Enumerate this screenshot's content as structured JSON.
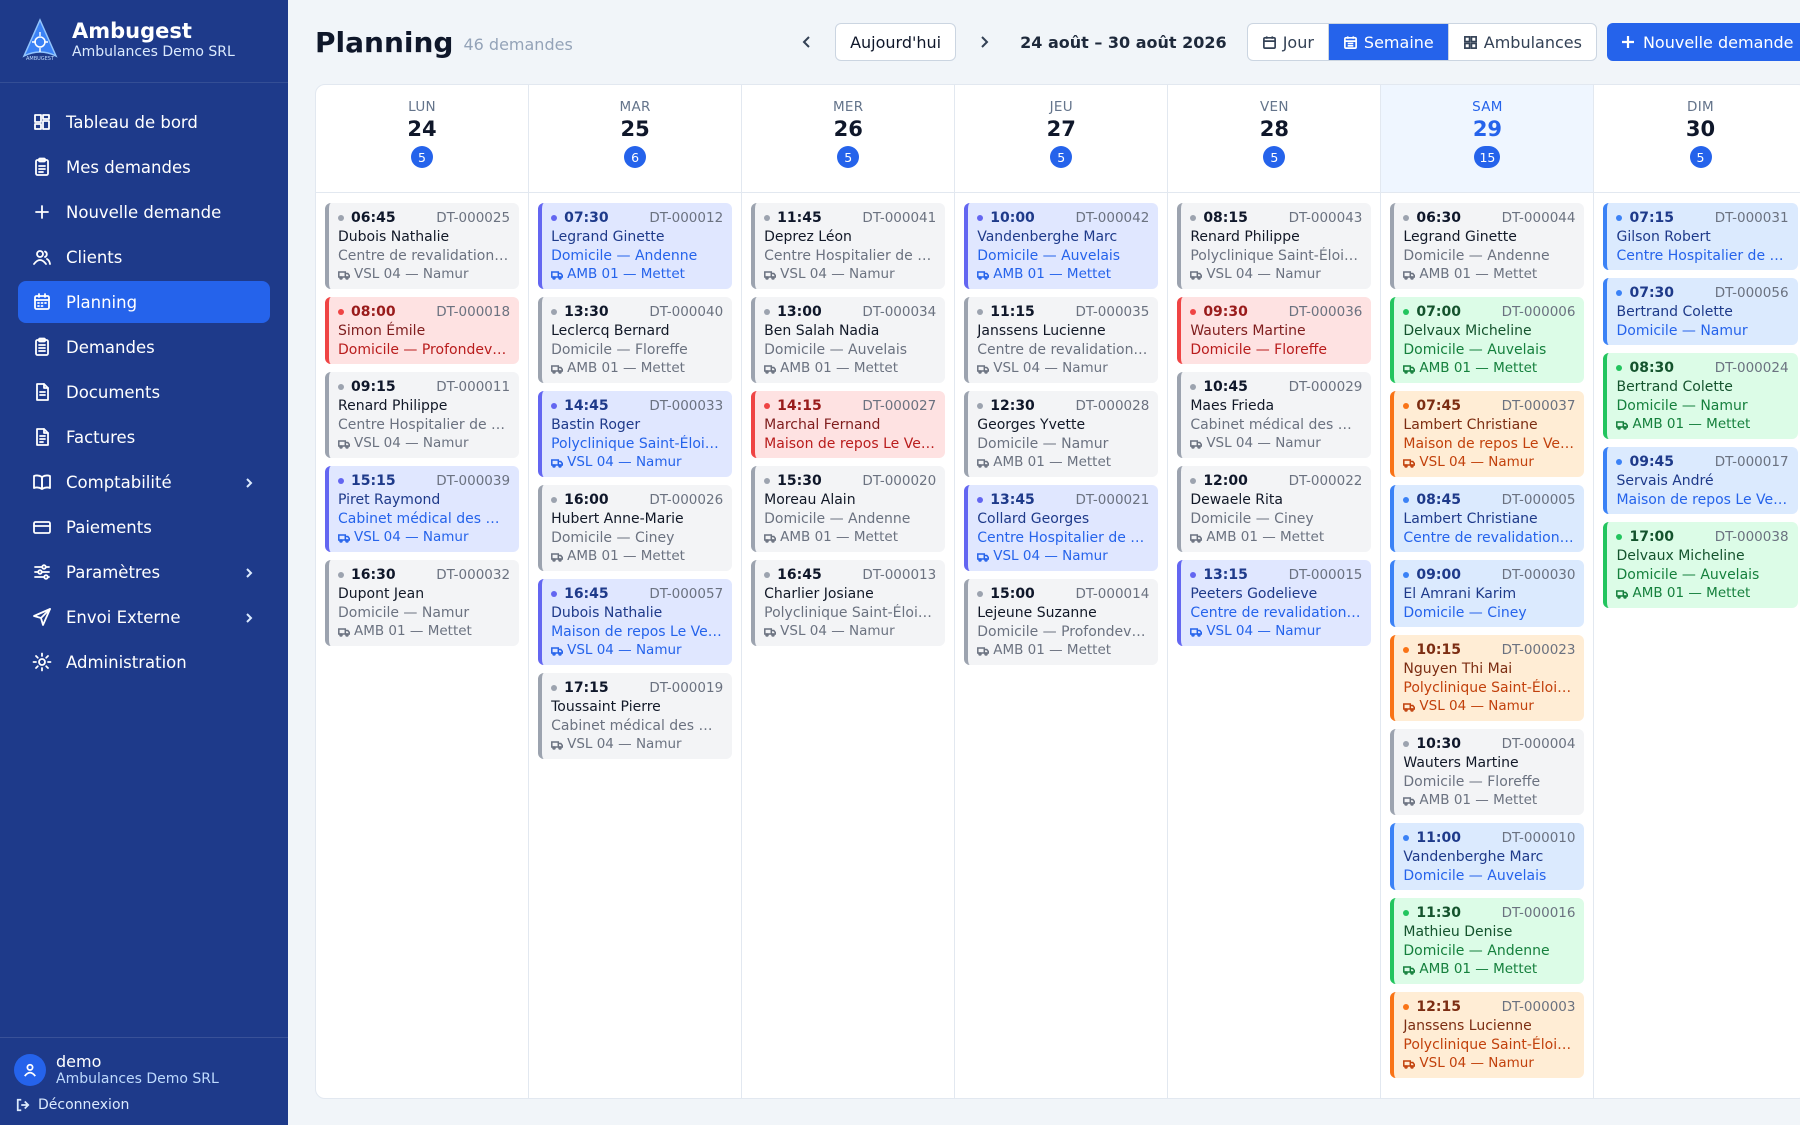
{
  "brand": {
    "title": "Ambugest",
    "subtitle": "Ambulances Demo SRL",
    "logo_text": "AMBUGEST"
  },
  "sidebar": {
    "items": [
      {
        "label": "Tableau de bord",
        "icon": "dashboard-icon",
        "active": false,
        "chevron": false
      },
      {
        "label": "Mes demandes",
        "icon": "clipboard-icon",
        "active": false,
        "chevron": false
      },
      {
        "label": "Nouvelle demande",
        "icon": "plus-icon",
        "active": false,
        "chevron": false
      },
      {
        "label": "Clients",
        "icon": "users-icon",
        "active": false,
        "chevron": false
      },
      {
        "label": "Planning",
        "icon": "calendar-icon",
        "active": true,
        "chevron": false
      },
      {
        "label": "Demandes",
        "icon": "clipboard-list-icon",
        "active": false,
        "chevron": false
      },
      {
        "label": "Documents",
        "icon": "document-icon",
        "active": false,
        "chevron": false
      },
      {
        "label": "Factures",
        "icon": "invoice-icon",
        "active": false,
        "chevron": false
      },
      {
        "label": "Comptabilité",
        "icon": "book-icon",
        "active": false,
        "chevron": true
      },
      {
        "label": "Paiements",
        "icon": "credit-card-icon",
        "active": false,
        "chevron": false
      },
      {
        "label": "Paramètres",
        "icon": "sliders-icon",
        "active": false,
        "chevron": true
      },
      {
        "label": "Envoi Externe",
        "icon": "send-icon",
        "active": false,
        "chevron": true
      },
      {
        "label": "Administration",
        "icon": "gear-icon",
        "active": false,
        "chevron": false
      }
    ]
  },
  "user": {
    "name": "demo",
    "org": "Ambulances Demo SRL",
    "logout_label": "Déconnexion"
  },
  "header": {
    "title": "Planning",
    "count": "46 demandes",
    "today_label": "Aujourd'hui",
    "date_range": "24 août – 30 août 2026",
    "views": [
      {
        "label": "Jour",
        "icon": "calendar-day-icon",
        "active": false
      },
      {
        "label": "Semaine",
        "icon": "calendar-week-icon",
        "active": true
      },
      {
        "label": "Ambulances",
        "icon": "grid-icon",
        "active": false
      }
    ],
    "new_label": "Nouvelle demande"
  },
  "colors": {
    "sidebar": "#1e3a8a",
    "accent": "#2563eb"
  },
  "days": [
    {
      "name": "LUN",
      "num": "24",
      "count": "5",
      "today": false,
      "cards": [
        {
          "time": "06:45",
          "id": "DT-000025",
          "name": "Dubois Nathalie",
          "loc": "Centre de revalidation…",
          "veh": "VSL 04 — Namur",
          "color": "gray"
        },
        {
          "time": "08:00",
          "id": "DT-000018",
          "name": "Simon Émile",
          "loc": "Domicile — Profondevi…",
          "veh": "",
          "color": "red"
        },
        {
          "time": "09:15",
          "id": "DT-000011",
          "name": "Renard Philippe",
          "loc": "Centre Hospitalier de …",
          "veh": "VSL 04 — Namur",
          "color": "gray"
        },
        {
          "time": "15:15",
          "id": "DT-000039",
          "name": "Piret Raymond",
          "loc": "Cabinet médical des Q…",
          "veh": "VSL 04 — Namur",
          "color": "indigo"
        },
        {
          "time": "16:30",
          "id": "DT-000032",
          "name": "Dupont Jean",
          "loc": "Domicile — Namur",
          "veh": "AMB 01 — Mettet",
          "color": "gray"
        }
      ]
    },
    {
      "name": "MAR",
      "num": "25",
      "count": "6",
      "today": false,
      "cards": [
        {
          "time": "07:30",
          "id": "DT-000012",
          "name": "Legrand Ginette",
          "loc": "Domicile — Andenne",
          "veh": "AMB 01 — Mettet",
          "color": "indigo"
        },
        {
          "time": "13:30",
          "id": "DT-000040",
          "name": "Leclercq Bernard",
          "loc": "Domicile — Floreffe",
          "veh": "AMB 01 — Mettet",
          "color": "gray"
        },
        {
          "time": "14:45",
          "id": "DT-000033",
          "name": "Bastin Roger",
          "loc": "Polyclinique Saint-Éloi …",
          "veh": "VSL 04 — Namur",
          "color": "indigo"
        },
        {
          "time": "16:00",
          "id": "DT-000026",
          "name": "Hubert Anne-Marie",
          "loc": "Domicile — Ciney",
          "veh": "AMB 01 — Mettet",
          "color": "gray"
        },
        {
          "time": "16:45",
          "id": "DT-000057",
          "name": "Dubois Nathalie",
          "loc": "Maison de repos Le Ve…",
          "veh": "VSL 04 — Namur",
          "color": "indigo"
        },
        {
          "time": "17:15",
          "id": "DT-000019",
          "name": "Toussaint Pierre",
          "loc": "Cabinet médical des Q…",
          "veh": "VSL 04 — Namur",
          "color": "gray"
        }
      ]
    },
    {
      "name": "MER",
      "num": "26",
      "count": "5",
      "today": false,
      "cards": [
        {
          "time": "11:45",
          "id": "DT-000041",
          "name": "Deprez Léon",
          "loc": "Centre Hospitalier de …",
          "veh": "VSL 04 — Namur",
          "color": "gray"
        },
        {
          "time": "13:00",
          "id": "DT-000034",
          "name": "Ben Salah Nadia",
          "loc": "Domicile — Auvelais",
          "veh": "AMB 01 — Mettet",
          "color": "gray"
        },
        {
          "time": "14:15",
          "id": "DT-000027",
          "name": "Marchal Fernand",
          "loc": "Maison de repos Le Ve…",
          "veh": "",
          "color": "red"
        },
        {
          "time": "15:30",
          "id": "DT-000020",
          "name": "Moreau Alain",
          "loc": "Domicile — Andenne",
          "veh": "AMB 01 — Mettet",
          "color": "gray"
        },
        {
          "time": "16:45",
          "id": "DT-000013",
          "name": "Charlier Josiane",
          "loc": "Polyclinique Saint-Éloi …",
          "veh": "VSL 04 — Namur",
          "color": "gray"
        }
      ]
    },
    {
      "name": "JEU",
      "num": "27",
      "count": "5",
      "today": false,
      "cards": [
        {
          "time": "10:00",
          "id": "DT-000042",
          "name": "Vandenberghe Marc",
          "loc": "Domicile — Auvelais",
          "veh": "AMB 01 — Mettet",
          "color": "indigo"
        },
        {
          "time": "11:15",
          "id": "DT-000035",
          "name": "Janssens Lucienne",
          "loc": "Centre de revalidation…",
          "veh": "VSL 04 — Namur",
          "color": "gray"
        },
        {
          "time": "12:30",
          "id": "DT-000028",
          "name": "Georges Yvette",
          "loc": "Domicile — Namur",
          "veh": "AMB 01 — Mettet",
          "color": "gray"
        },
        {
          "time": "13:45",
          "id": "DT-000021",
          "name": "Collard Georges",
          "loc": "Centre Hospitalier de …",
          "veh": "VSL 04 — Namur",
          "color": "indigo"
        },
        {
          "time": "15:00",
          "id": "DT-000014",
          "name": "Lejeune Suzanne",
          "loc": "Domicile — Profondevi…",
          "veh": "AMB 01 — Mettet",
          "color": "gray"
        }
      ]
    },
    {
      "name": "VEN",
      "num": "28",
      "count": "5",
      "today": false,
      "cards": [
        {
          "time": "08:15",
          "id": "DT-000043",
          "name": "Renard Philippe",
          "loc": "Polyclinique Saint-Éloi …",
          "veh": "VSL 04 — Namur",
          "color": "gray"
        },
        {
          "time": "09:30",
          "id": "DT-000036",
          "name": "Wauters Martine",
          "loc": "Domicile — Floreffe",
          "veh": "",
          "color": "red"
        },
        {
          "time": "10:45",
          "id": "DT-000029",
          "name": "Maes Frieda",
          "loc": "Cabinet médical des Q…",
          "veh": "VSL 04 — Namur",
          "color": "gray"
        },
        {
          "time": "12:00",
          "id": "DT-000022",
          "name": "Dewaele Rita",
          "loc": "Domicile — Ciney",
          "veh": "AMB 01 — Mettet",
          "color": "gray"
        },
        {
          "time": "13:15",
          "id": "DT-000015",
          "name": "Peeters Godelieve",
          "loc": "Centre de revalidation…",
          "veh": "VSL 04 — Namur",
          "color": "indigo"
        }
      ]
    },
    {
      "name": "SAM",
      "num": "29",
      "count": "15",
      "today": true,
      "cards": [
        {
          "time": "06:30",
          "id": "DT-000044",
          "name": "Legrand Ginette",
          "loc": "Domicile — Andenne",
          "veh": "AMB 01 — Mettet",
          "color": "gray"
        },
        {
          "time": "07:00",
          "id": "DT-000006",
          "name": "Delvaux Micheline",
          "loc": "Domicile — Auvelais",
          "veh": "AMB 01 — Mettet",
          "color": "green"
        },
        {
          "time": "07:45",
          "id": "DT-000037",
          "name": "Lambert Christiane",
          "loc": "Maison de repos Le Ve…",
          "veh": "VSL 04 — Namur",
          "color": "orange"
        },
        {
          "time": "08:45",
          "id": "DT-000005",
          "name": "Lambert Christiane",
          "loc": "Centre de revalidation…",
          "veh": "",
          "color": "blue"
        },
        {
          "time": "09:00",
          "id": "DT-000030",
          "name": "El Amrani Karim",
          "loc": "Domicile — Ciney",
          "veh": "",
          "color": "blue"
        },
        {
          "time": "10:15",
          "id": "DT-000023",
          "name": "Nguyen Thi Mai",
          "loc": "Polyclinique Saint-Éloi …",
          "veh": "VSL 04 — Namur",
          "color": "orange"
        },
        {
          "time": "10:30",
          "id": "DT-000004",
          "name": "Wauters Martine",
          "loc": "Domicile — Floreffe",
          "veh": "AMB 01 — Mettet",
          "color": "gray"
        },
        {
          "time": "11:00",
          "id": "DT-000010",
          "name": "Vandenberghe Marc",
          "loc": "Domicile — Auvelais",
          "veh": "",
          "color": "blue"
        },
        {
          "time": "11:30",
          "id": "DT-000016",
          "name": "Mathieu Denise",
          "loc": "Domicile — Andenne",
          "veh": "AMB 01 — Mettet",
          "color": "green"
        },
        {
          "time": "12:15",
          "id": "DT-000003",
          "name": "Janssens Lucienne",
          "loc": "Polyclinique Saint-Éloi …",
          "veh": "VSL 04 — Namur",
          "color": "orange"
        }
      ]
    },
    {
      "name": "DIM",
      "num": "30",
      "count": "5",
      "today": false,
      "cards": [
        {
          "time": "07:15",
          "id": "DT-000031",
          "name": "Gilson Robert",
          "loc": "Centre Hospitalier de …",
          "veh": "",
          "color": "blue"
        },
        {
          "time": "07:30",
          "id": "DT-000056",
          "name": "Bertrand Colette",
          "loc": "Domicile — Namur",
          "veh": "",
          "color": "blue"
        },
        {
          "time": "08:30",
          "id": "DT-000024",
          "name": "Bertrand Colette",
          "loc": "Domicile — Namur",
          "veh": "AMB 01 — Mettet",
          "color": "green"
        },
        {
          "time": "09:45",
          "id": "DT-000017",
          "name": "Servais André",
          "loc": "Maison de repos Le Ve…",
          "veh": "",
          "color": "blue"
        },
        {
          "time": "17:00",
          "id": "DT-000038",
          "name": "Delvaux Micheline",
          "loc": "Domicile — Auvelais",
          "veh": "AMB 01 — Mettet",
          "color": "green"
        }
      ]
    }
  ]
}
